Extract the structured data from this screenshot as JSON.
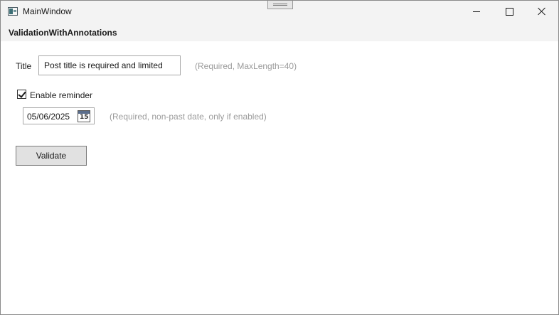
{
  "window": {
    "title": "MainWindow",
    "app_icon": "window-app-icon",
    "controls": {
      "minimize": "minimize-icon",
      "maximize": "maximize-icon",
      "close": "close-icon"
    }
  },
  "header": {
    "title": "ValidationWithAnnotations"
  },
  "form": {
    "title_label": "Title",
    "title_value": "Post title is required and limited",
    "title_hint": "(Required, MaxLength=40)",
    "reminder_label": "Enable reminder",
    "reminder_checked": true,
    "date_value": "05/06/2025",
    "calendar_day": "15",
    "date_hint": "(Required, non-past date, only if enabled)",
    "validate_label": "Validate"
  }
}
